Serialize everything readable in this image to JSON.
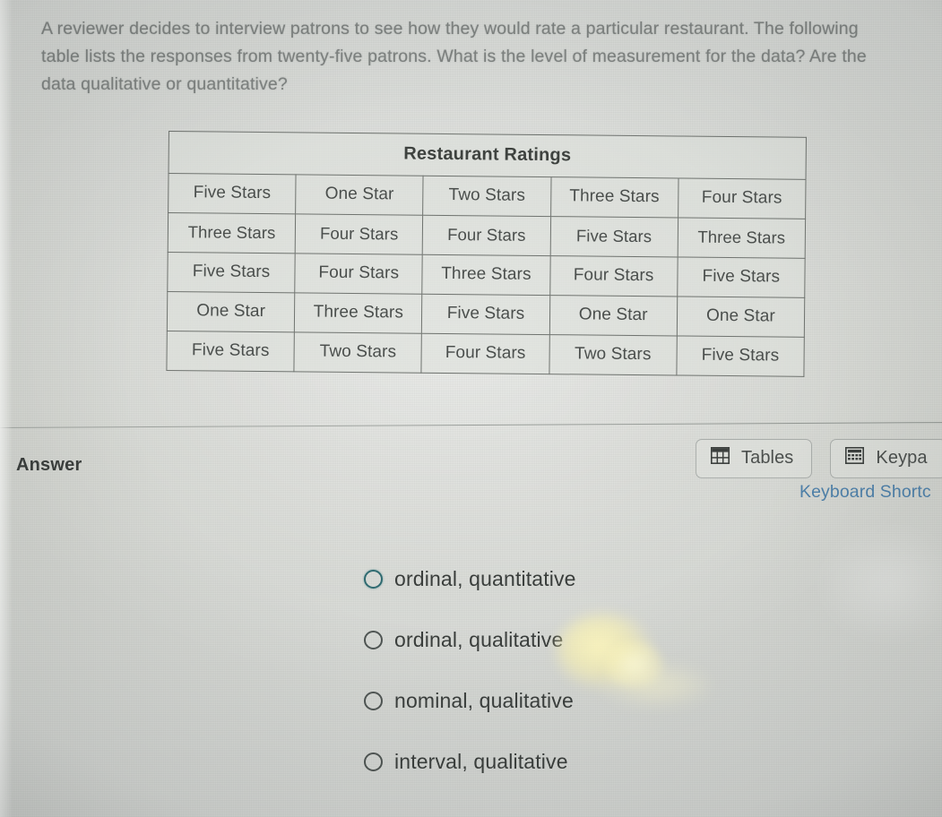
{
  "prompt": {
    "text": "A reviewer decides to interview patrons to see how they would rate a particular restaurant. The following table lists the responses from twenty-five patrons. What is the level of measurement for the data? Are the data qualitative or quantitative?"
  },
  "table": {
    "title": "Restaurant Ratings",
    "rows": [
      [
        "Five Stars",
        "One Star",
        "Two Stars",
        "Three Stars",
        "Four Stars"
      ],
      [
        "Three Stars",
        "Four Stars",
        "Four Stars",
        "Five Stars",
        "Three Stars"
      ],
      [
        "Five Stars",
        "Four Stars",
        "Three Stars",
        "Four Stars",
        "Five Stars"
      ],
      [
        "One Star",
        "Three Stars",
        "Five Stars",
        "One Star",
        "One Star"
      ],
      [
        "Five Stars",
        "Two Stars",
        "Four Stars",
        "Two Stars",
        "Five Stars"
      ]
    ]
  },
  "answer": {
    "label": "Answer",
    "keyboard_shortcuts_link": "Keyboard Shortc"
  },
  "toolbar": {
    "tables_label": "Tables",
    "tables_icon": "table-grid-icon",
    "keypad_label": "Keypa",
    "keypad_icon": "calculator-keypad-icon"
  },
  "options": [
    {
      "label": "ordinal, quantitative",
      "selected": false,
      "focused": true
    },
    {
      "label": "ordinal, qualitative",
      "selected": false,
      "focused": false
    },
    {
      "label": "nominal, qualitative",
      "selected": false,
      "focused": false
    },
    {
      "label": "interval, qualitative",
      "selected": false,
      "focused": false
    }
  ],
  "colors": {
    "page_background": "#d8dad6",
    "text_primary": "#3a3e3c",
    "text_prompt": "#7e8280",
    "link_blue": "#4d7fa8",
    "table_border": "#6f736f",
    "focus_ring": "#2f6a70"
  }
}
